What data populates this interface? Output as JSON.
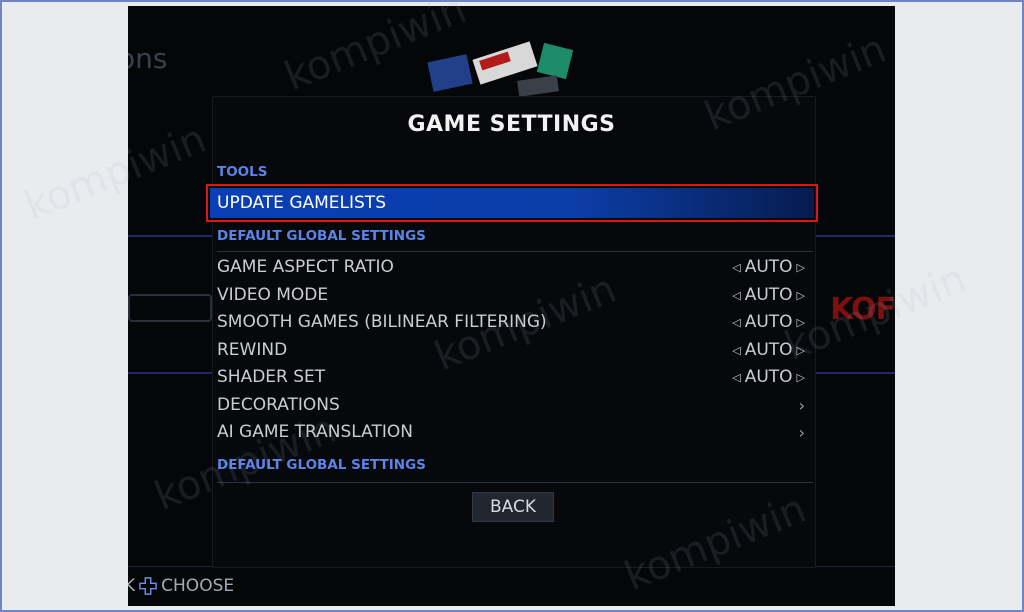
{
  "background": {
    "title_fragment": "ons",
    "logo_fragment": "KOF",
    "footer_fragment": "K"
  },
  "dialog": {
    "title": "GAME SETTINGS",
    "sections": [
      {
        "label": "TOOLS"
      },
      {
        "label": "DEFAULT GLOBAL SETTINGS"
      },
      {
        "label": "DEFAULT GLOBAL SETTINGS"
      }
    ],
    "selected_item": "UPDATE GAMELISTS",
    "settings": [
      {
        "label": "GAME ASPECT RATIO",
        "value": "AUTO"
      },
      {
        "label": "VIDEO MODE",
        "value": "AUTO"
      },
      {
        "label": "SMOOTH GAMES (BILINEAR FILTERING)",
        "value": "AUTO"
      },
      {
        "label": "REWIND",
        "value": "AUTO"
      },
      {
        "label": "SHADER SET",
        "value": "AUTO"
      }
    ],
    "links": [
      {
        "label": "DECORATIONS",
        "icon": "chevron-right-icon"
      },
      {
        "label": "AI GAME TRANSLATION",
        "icon": "chevron-right-icon"
      }
    ],
    "back_label": "BACK"
  },
  "footer": {
    "choose_label": "CHOOSE",
    "icon": "dpad-icon"
  },
  "watermark": "kompiwin",
  "colors": {
    "accent": "#0a3fb5",
    "section_text": "#5c84e6",
    "highlight_border": "#e11414"
  }
}
